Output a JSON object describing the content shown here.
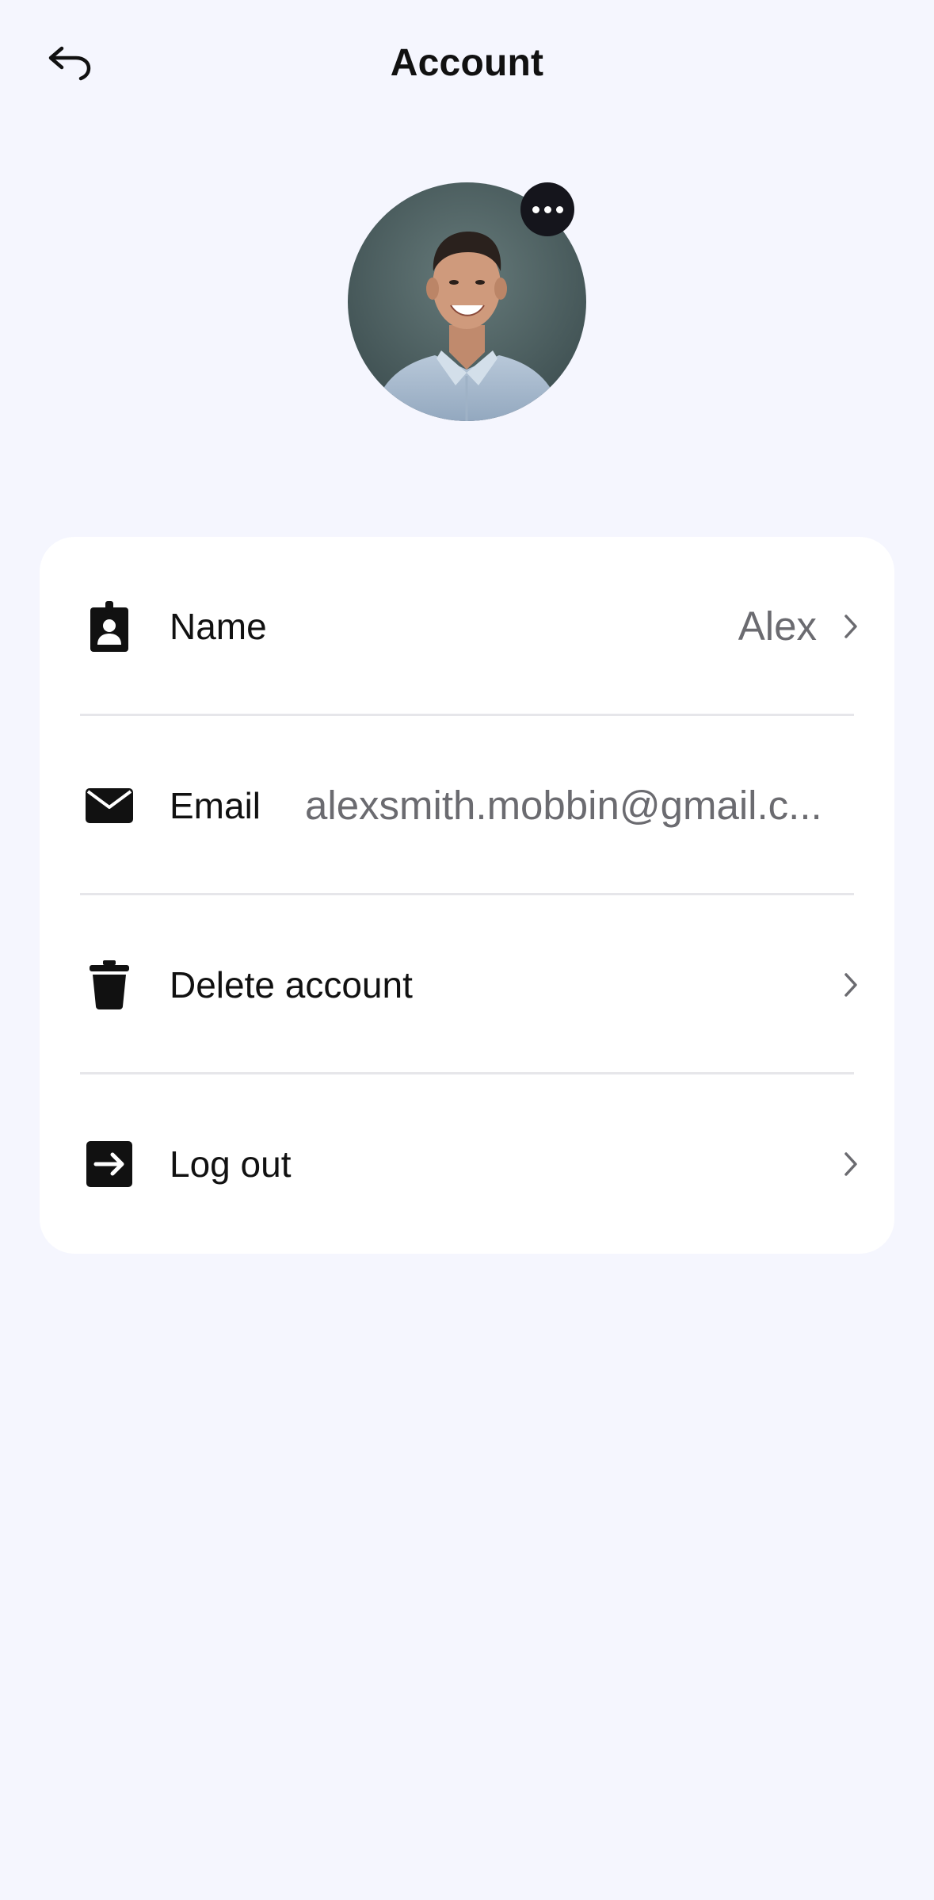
{
  "header": {
    "title": "Account"
  },
  "avatar": {
    "image": "profile-photo",
    "menu_icon": "more-horizontal-icon"
  },
  "settings": {
    "rows": [
      {
        "label": "Name",
        "value": "Alex",
        "icon": "contact-badge-icon",
        "chevron": true
      },
      {
        "label": "Email",
        "value": "alexsmith.mobbin@gmail.c...",
        "icon": "envelope-icon",
        "chevron": false
      },
      {
        "label": "Delete account",
        "value": "",
        "icon": "trash-icon",
        "chevron": true
      },
      {
        "label": "Log out",
        "value": "",
        "icon": "logout-icon",
        "chevron": true
      }
    ]
  },
  "colors": {
    "background": "#f5f6fe",
    "card": "#ffffff",
    "text_primary": "#111111",
    "text_secondary": "#6b6b70",
    "divider": "#e6e6ea",
    "menu_button": "#15151c"
  }
}
